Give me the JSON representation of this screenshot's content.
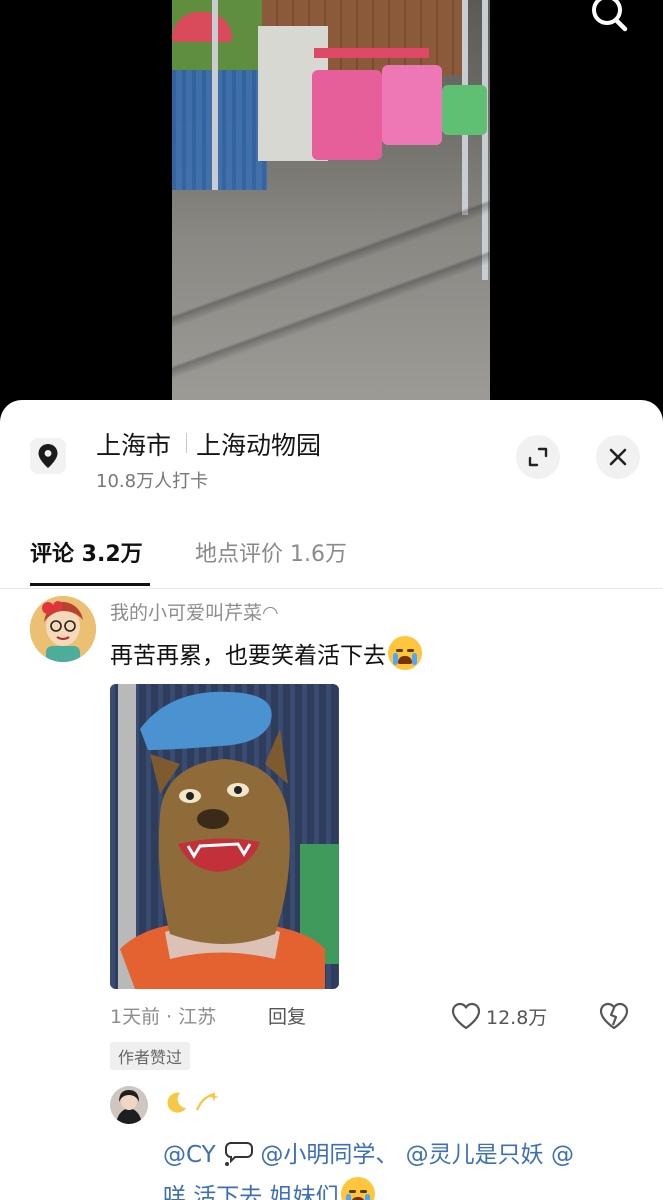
{
  "location": {
    "city": "上海市",
    "place": "上海动物园",
    "checkins": "10.8万人打卡"
  },
  "tabs": [
    {
      "label": "评论 3.2万",
      "active": true
    },
    {
      "label": "地点评价 1.6万",
      "active": false
    }
  ],
  "comment": {
    "username": "我的小可爱叫芹菜◠",
    "text": "再苦再累，也要笑着活下去",
    "text_emoji": "loudly-crying-face-icon",
    "time_location": "1天前 · 江苏",
    "reply_label": "回复",
    "likes": "12.8万",
    "author_badge": "作者赞过"
  },
  "reply": {
    "user_emojis": [
      "crescent-moon-icon",
      "dizzy-icon"
    ],
    "mentions": [
      "@CY",
      "@小明同学、",
      "@灵儿是只妖",
      "@"
    ],
    "mention_emoji": "thought-balloon-icon",
    "text_tail": "咩 活下去 姐妹们",
    "tail_emoji": "loudly-crying-face-icon"
  },
  "colors": {
    "background": "#000000",
    "sheet": "#ffffff",
    "mention": "#3d6fb8",
    "muted_text": "#8d8d8d"
  }
}
